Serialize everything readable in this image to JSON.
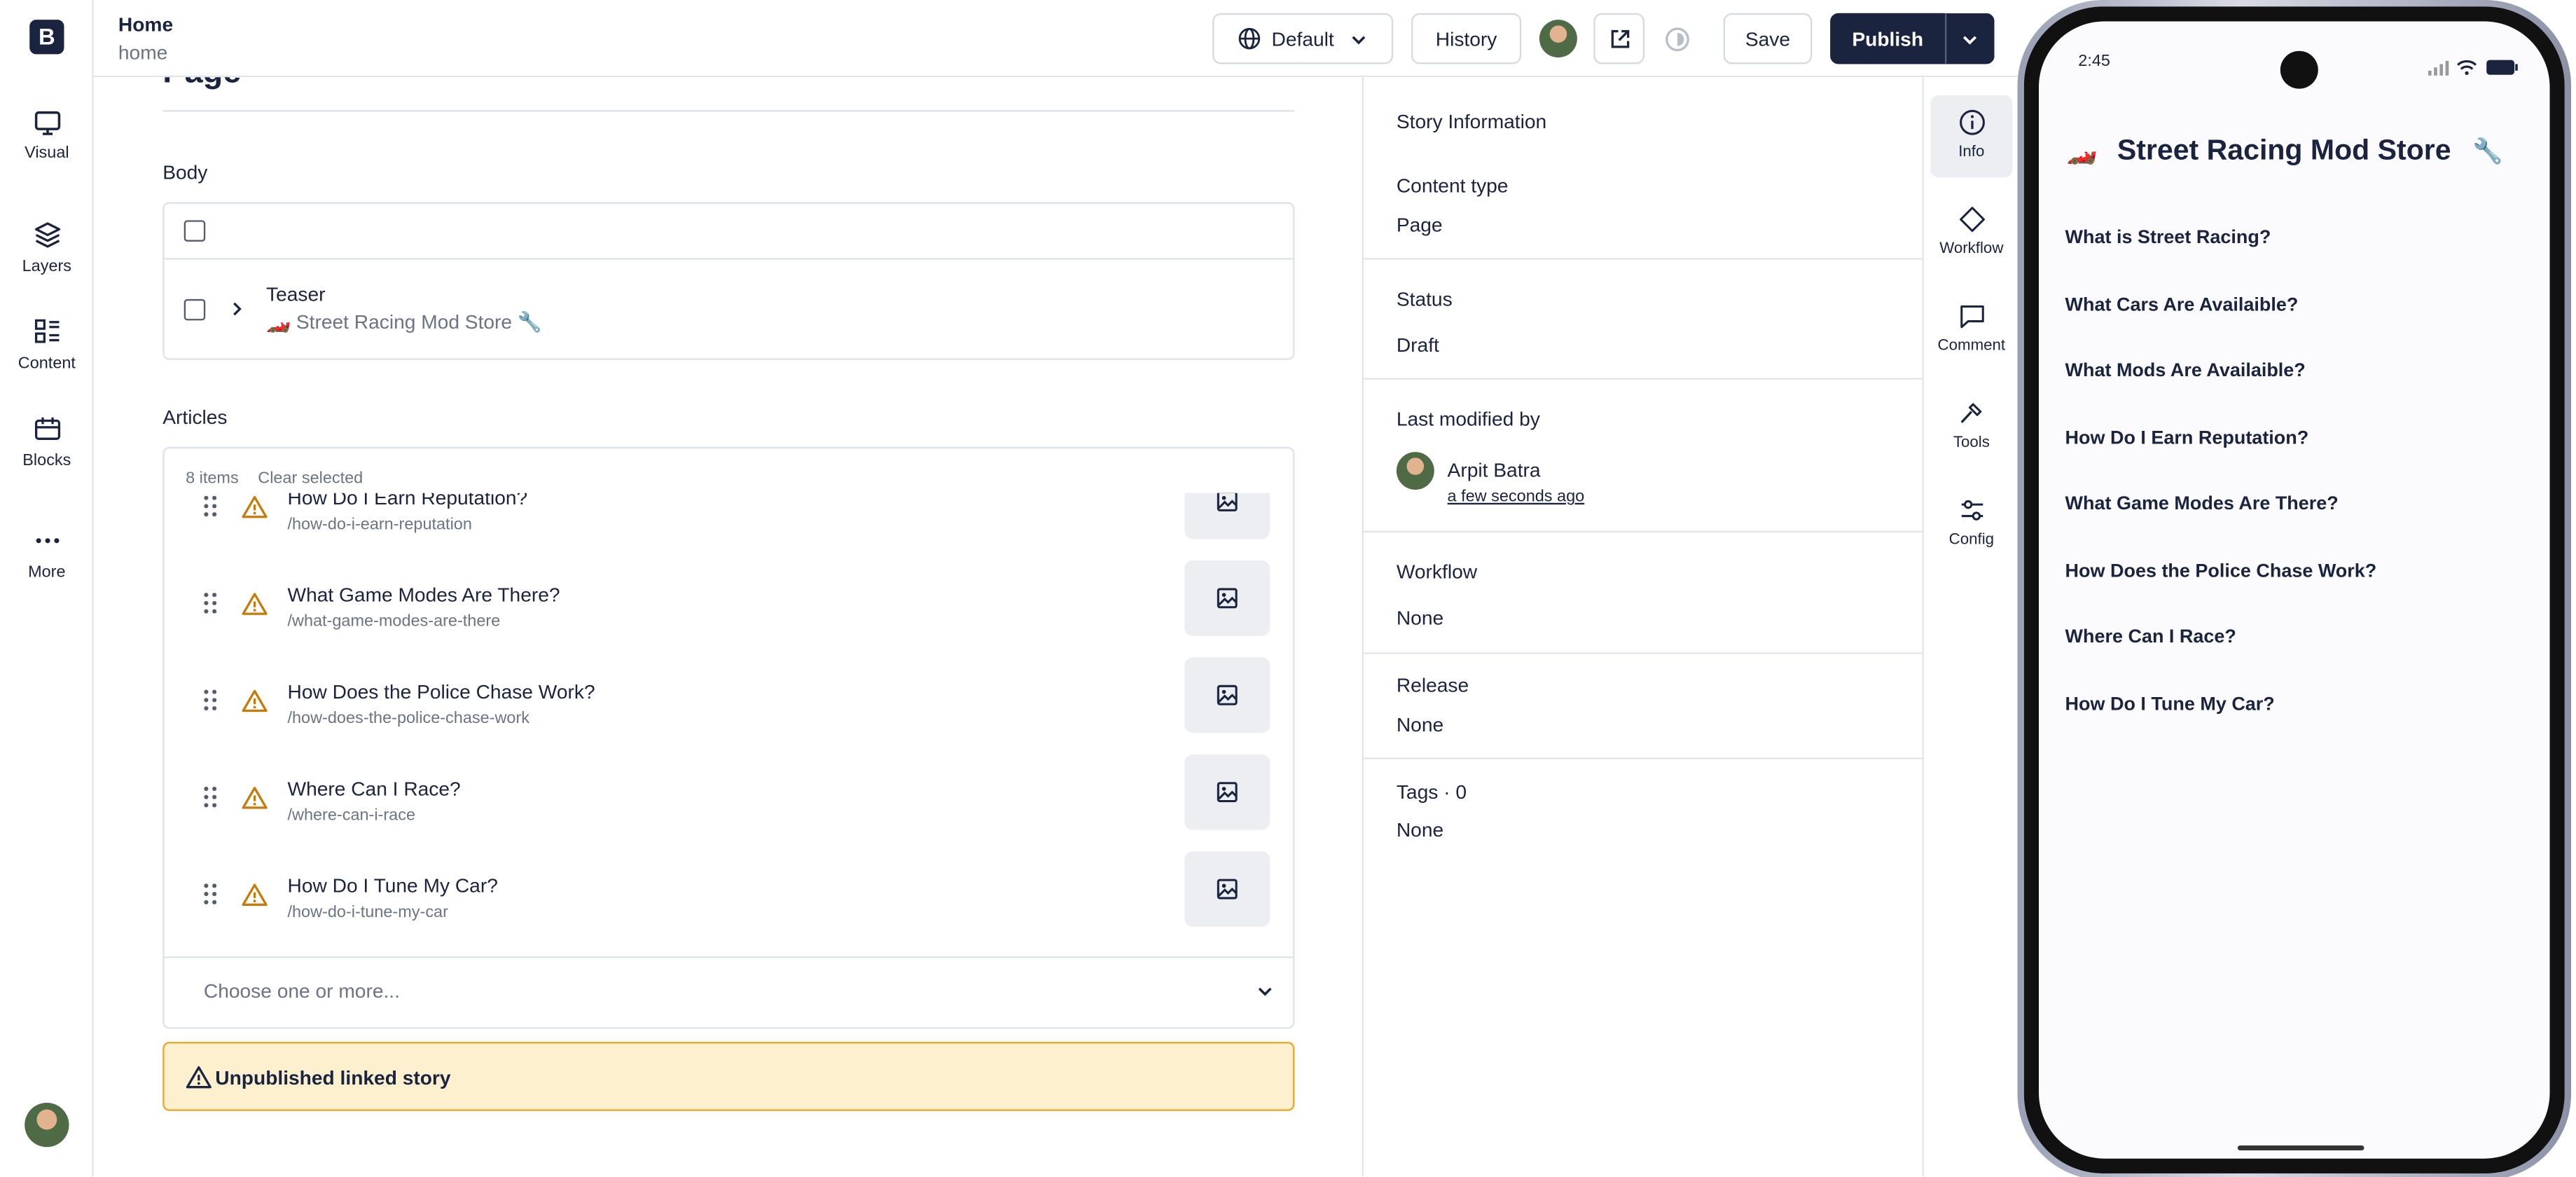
{
  "app": {
    "logo_letter": "B"
  },
  "rail": {
    "items": [
      {
        "label": "Visual",
        "icon": "monitor-icon"
      },
      {
        "label": "Layers",
        "icon": "layers-icon"
      },
      {
        "label": "Content",
        "icon": "content-grid-icon"
      },
      {
        "label": "Blocks",
        "icon": "blocks-icon"
      },
      {
        "label": "More",
        "icon": "more-dots-icon"
      }
    ]
  },
  "topbar": {
    "title": "Home",
    "subtitle": "home",
    "language": "Default",
    "history": "History",
    "save": "Save",
    "publish": "Publish"
  },
  "main": {
    "partial_heading": "Page",
    "body_label": "Body",
    "teaser": {
      "type": "Teaser",
      "title": "🏎️ Street Racing Mod Store 🔧"
    },
    "articles_label": "Articles",
    "items_count": "8 items",
    "clear_selected": "Clear selected",
    "articles": [
      {
        "title": "How Do I Earn Reputation?",
        "slug": "/how-do-i-earn-reputation"
      },
      {
        "title": "What Game Modes Are There?",
        "slug": "/what-game-modes-are-there"
      },
      {
        "title": "How Does the Police Chase Work?",
        "slug": "/how-does-the-police-chase-work"
      },
      {
        "title": "Where Can I Race?",
        "slug": "/where-can-i-race"
      },
      {
        "title": "How Do I Tune My Car?",
        "slug": "/how-do-i-tune-my-car"
      }
    ],
    "choose_placeholder": "Choose one or more...",
    "warning": "Unpublished linked story"
  },
  "panel": {
    "heading": "Story Information",
    "content_type_label": "Content type",
    "content_type": "Page",
    "status_label": "Status",
    "status": "Draft",
    "last_modified_label": "Last modified by",
    "modified_by": "Arpit Batra",
    "modified_when": "a few seconds ago",
    "workflow_label": "Workflow",
    "workflow": "None",
    "release_label": "Release",
    "release": "None",
    "tags_label": "Tags · 0",
    "tags": "None"
  },
  "tabs": [
    {
      "label": "Info",
      "icon": "info-icon"
    },
    {
      "label": "Workflow",
      "icon": "workflow-diamond-icon"
    },
    {
      "label": "Comment",
      "icon": "comment-icon"
    },
    {
      "label": "Tools",
      "icon": "hammer-icon"
    },
    {
      "label": "Config",
      "icon": "sliders-icon"
    }
  ],
  "phone": {
    "time": "2:45",
    "store_title": "Street Racing Mod Store",
    "title_emoji_left": "🏎️",
    "title_emoji_right": "🔧",
    "links": [
      "What is Street Racing?",
      "What Cars Are Availaible?",
      "What Mods Are Availaible?",
      "How Do I Earn Reputation?",
      "What Game Modes Are There?",
      "How Does the Police Chase Work?",
      "Where Can I Race?",
      "How Do I Tune My Car?"
    ]
  },
  "colors": {
    "brand_dark": "#1b243f",
    "warning_bg": "#fdf0cf",
    "warning_border": "#e9a72c",
    "warning_icon": "#c77a0a"
  }
}
